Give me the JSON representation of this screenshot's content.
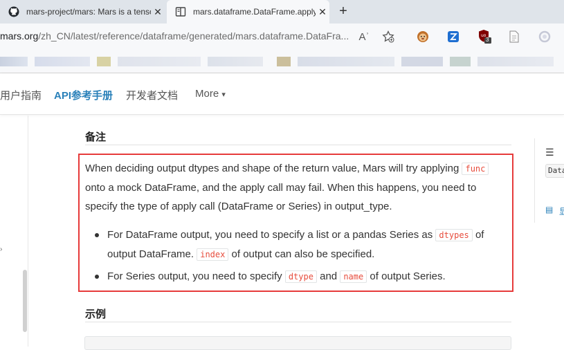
{
  "browser": {
    "tabs": [
      {
        "title": "mars-project/mars: Mars is a tensor-based unified framework",
        "icon": "github-icon"
      },
      {
        "title": "mars.dataframe.DataFrame.apply",
        "icon": "book-icon"
      }
    ],
    "close_glyph": "✕",
    "new_tab_glyph": "+",
    "url_host": "mars.org",
    "url_path": "/zh_CN/latest/reference/dataframe/generated/mars.dataframe.DataFra...",
    "read_aloud_glyph": "Aʾ",
    "extension_badge": "3"
  },
  "nav": {
    "items": [
      "用户指南",
      "API参考手册",
      "开发者文档",
      "More"
    ],
    "active_index": 1,
    "more_caret": "▾"
  },
  "content": {
    "notes_heading": "备注",
    "para": {
      "t1": "When deciding output dtypes and shape of the return value, Mars will try applying ",
      "c1": "func",
      "t2": " onto a mock DataFrame, and the apply call may fail. When this happens, you need to specify the type of apply call (DataFrame or Series) in output_type."
    },
    "bullet1": {
      "t1": "For DataFrame output, you need to specify a list or a pandas Series as ",
      "c1": "dtypes",
      "t2": " of output DataFrame. ",
      "c2": "index",
      "t3": " of output can also be specified."
    },
    "bullet2": {
      "t1": "For Series output, you need to specify ",
      "c1": "dtype",
      "t2": " and ",
      "c2": "name",
      "t3": " of output Series."
    },
    "examples_heading": "示例"
  },
  "right_sidebar": {
    "list_glyph": "☰",
    "code_snip": "Data",
    "doc_glyph": "▤",
    "doc_text": "显"
  },
  "left_sidebar": {
    "mark": "›"
  },
  "colors": {
    "accent": "#2980b9",
    "highlight_border": "#e63a3a",
    "code_text": "#e74c3c"
  }
}
